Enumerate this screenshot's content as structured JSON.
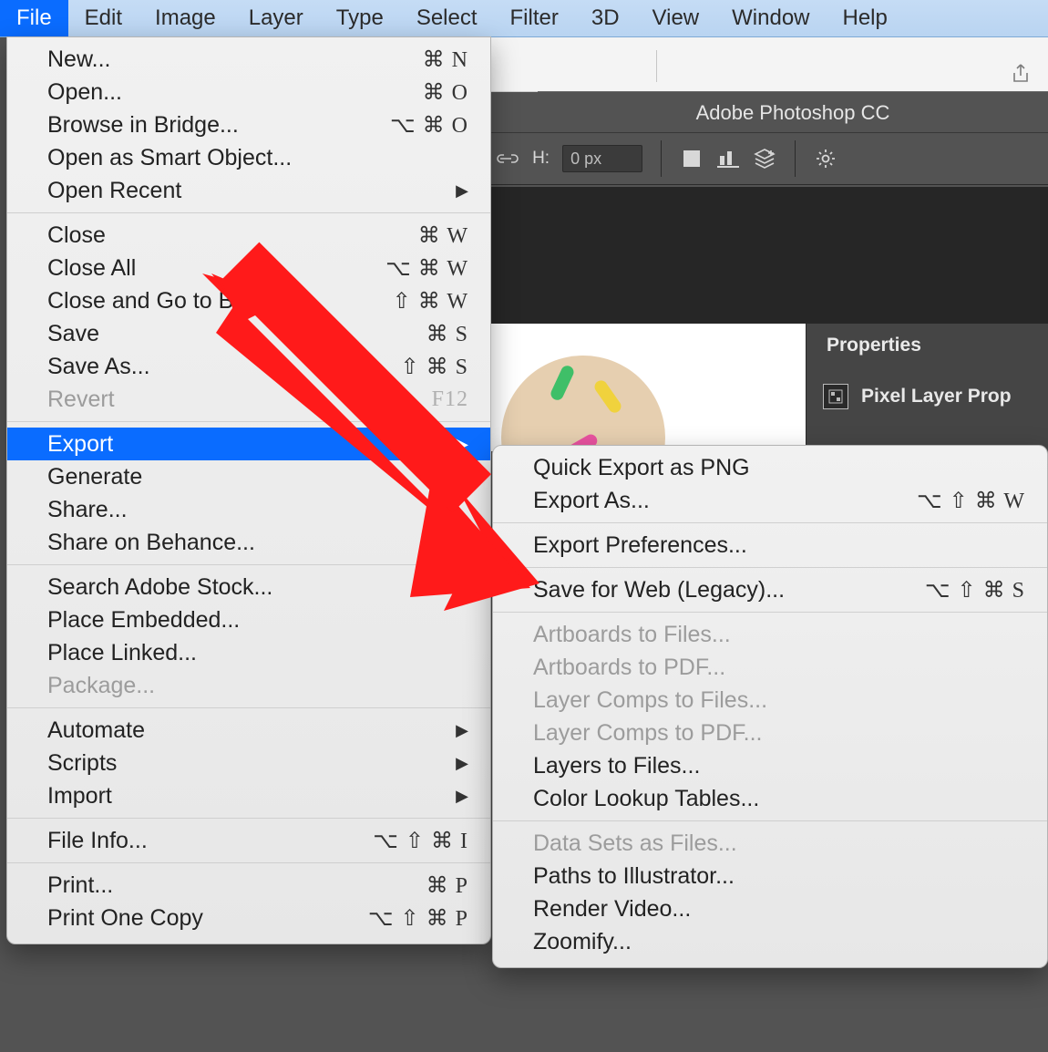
{
  "menubar": {
    "items": [
      "File",
      "Edit",
      "Image",
      "Layer",
      "Type",
      "Select",
      "Filter",
      "3D",
      "View",
      "Window",
      "Help"
    ],
    "active_index": 0
  },
  "app": {
    "title": "Adobe Photoshop CC",
    "options_bar": {
      "px_suffix_1": "px",
      "link_icon": "link-icon",
      "h_label": "H:",
      "h_value": "0 px",
      "align_a_icon": "fill-swatch-icon",
      "align_b_icon": "align-bottom-icon",
      "stack_icon": "layers-stack-icon",
      "gear_icon": "gear-icon"
    },
    "properties_panel": {
      "tab": "Properties",
      "body": "Pixel Layer Prop"
    }
  },
  "file_menu": [
    {
      "label": "New...",
      "shortcut": "⌘ N"
    },
    {
      "label": "Open...",
      "shortcut": "⌘ O"
    },
    {
      "label": "Browse in Bridge...",
      "shortcut": "⌥ ⌘ O"
    },
    {
      "label": "Open as Smart Object..."
    },
    {
      "label": "Open Recent",
      "submenu": true
    },
    {
      "sep": true
    },
    {
      "label": "Close",
      "shortcut": "⌘ W"
    },
    {
      "label": "Close All",
      "shortcut": "⌥ ⌘ W"
    },
    {
      "label": "Close and Go to Bridge...",
      "shortcut": "⇧ ⌘ W"
    },
    {
      "label": "Save",
      "shortcut": "⌘ S"
    },
    {
      "label": "Save As...",
      "shortcut": "⇧ ⌘ S"
    },
    {
      "label": "Revert",
      "shortcut": "F12",
      "disabled": true
    },
    {
      "sep": true
    },
    {
      "label": "Export",
      "submenu": true,
      "highlight": true
    },
    {
      "label": "Generate",
      "submenu": true
    },
    {
      "label": "Share..."
    },
    {
      "label": "Share on Behance..."
    },
    {
      "sep": true
    },
    {
      "label": "Search Adobe Stock..."
    },
    {
      "label": "Place Embedded..."
    },
    {
      "label": "Place Linked..."
    },
    {
      "label": "Package...",
      "disabled": true
    },
    {
      "sep": true
    },
    {
      "label": "Automate",
      "submenu": true
    },
    {
      "label": "Scripts",
      "submenu": true
    },
    {
      "label": "Import",
      "submenu": true
    },
    {
      "sep": true
    },
    {
      "label": "File Info...",
      "shortcut": "⌥ ⇧ ⌘ I"
    },
    {
      "sep": true
    },
    {
      "label": "Print...",
      "shortcut": "⌘ P"
    },
    {
      "label": "Print One Copy",
      "shortcut": "⌥ ⇧ ⌘ P"
    }
  ],
  "export_menu": [
    {
      "label": "Quick Export as PNG"
    },
    {
      "label": "Export As...",
      "shortcut": "⌥ ⇧ ⌘ W"
    },
    {
      "sep": true
    },
    {
      "label": "Export Preferences..."
    },
    {
      "sep": true
    },
    {
      "label": "Save for Web (Legacy)...",
      "shortcut": "⌥ ⇧ ⌘ S"
    },
    {
      "sep": true
    },
    {
      "label": "Artboards to Files...",
      "disabled": true
    },
    {
      "label": "Artboards to PDF...",
      "disabled": true
    },
    {
      "label": "Layer Comps to Files...",
      "disabled": true
    },
    {
      "label": "Layer Comps to PDF...",
      "disabled": true
    },
    {
      "label": "Layers to Files..."
    },
    {
      "label": "Color Lookup Tables..."
    },
    {
      "sep": true
    },
    {
      "label": "Data Sets as Files...",
      "disabled": true
    },
    {
      "label": "Paths to Illustrator..."
    },
    {
      "label": "Render Video..."
    },
    {
      "label": "Zoomify..."
    }
  ]
}
